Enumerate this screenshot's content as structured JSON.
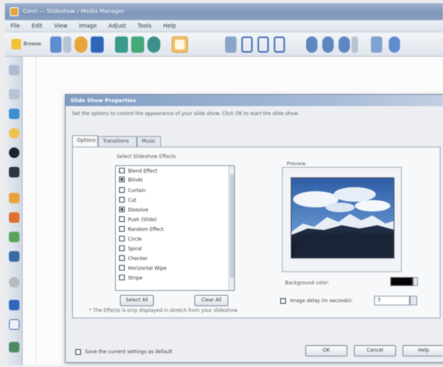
{
  "window": {
    "title": "Corel — Slideshow / Media Manager"
  },
  "menu": [
    "File",
    "Edit",
    "View",
    "Image",
    "Adjust",
    "Tools",
    "Help"
  ],
  "toolbar": {
    "first_label": "Browse",
    "icons": [
      "browse-icon",
      "view-icon",
      "email-icon",
      "save-icon",
      "film-icon",
      "print-icon",
      "refresh-icon",
      "slideshow-icon",
      "zoom-icon",
      "frame-icon",
      "crop-icon",
      "rotate-icon",
      "magnify-icon",
      "magnify-minus-icon",
      "search-icon",
      "share-icon",
      "help-icon"
    ]
  },
  "dialog": {
    "title": "Slide Show Properties",
    "description": "Set the options to control the appearance of your slide show. Click OK to start the slide show.",
    "tabs": [
      "Options",
      "Transitions",
      "Music"
    ],
    "list_label": "Select Slideshow Effects",
    "effects": [
      {
        "label": "Blend Effect",
        "checked": false
      },
      {
        "label": "Blinds",
        "checked": true
      },
      {
        "label": "Curtain",
        "checked": false
      },
      {
        "label": "Cut",
        "checked": false
      },
      {
        "label": "Dissolve",
        "checked": true
      },
      {
        "label": "Push (Slide)",
        "checked": false
      },
      {
        "label": "Random Effect",
        "checked": false
      },
      {
        "label": "Circle",
        "checked": false
      },
      {
        "label": "Spiral",
        "checked": false
      },
      {
        "label": "Checker",
        "checked": false
      },
      {
        "label": "Horizontal Wipe",
        "checked": false
      },
      {
        "label": "Stripe",
        "checked": false
      }
    ],
    "select_all": "Select All",
    "clear_all": "Clear All",
    "note": "* The Effects is only displayed in stretch from your slideshow",
    "preview_label": "Preview",
    "bg_color_label": "Background color:",
    "bg_color": "#050505",
    "delay_label": "Image delay (in seconds):",
    "delay_checked": false,
    "delay_value": "3",
    "default_label": "Save the current settings as default",
    "default_checked": false,
    "ok": "OK",
    "cancel": "Cancel",
    "help": "Help"
  }
}
